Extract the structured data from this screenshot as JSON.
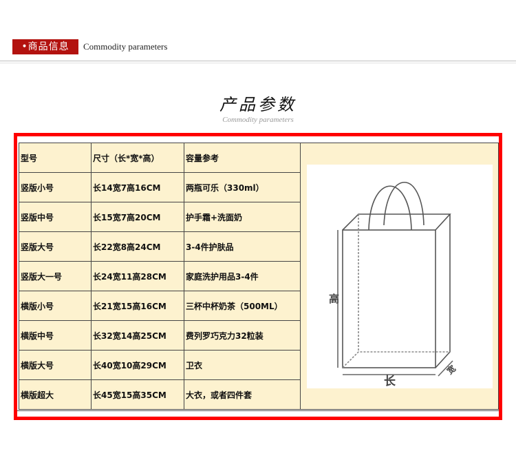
{
  "header": {
    "tag": "•商品信息",
    "subtitle": "Commodity parameters"
  },
  "title": "产品参数",
  "subtitle": "Commodity parameters",
  "table": {
    "headers": [
      "型号",
      "尺寸（长*宽*高）",
      "容量参考"
    ],
    "rows": [
      [
        "竖版小号",
        "长14宽7高16CM",
        "两瓶可乐（330ml）"
      ],
      [
        "竖版中号",
        "长15宽7高20CM",
        "护手霜+洗面奶"
      ],
      [
        "竖版大号",
        "长22宽8高24CM",
        "3-4件护肤品"
      ],
      [
        "竖版大一号",
        "长24宽11高28CM",
        "家庭洗护用品3-4件"
      ],
      [
        "横版小号",
        "长21宽15高16CM",
        "三杯中杯奶茶（500ML）"
      ],
      [
        "横版中号",
        "长32宽14高25CM",
        "费列罗巧克力32粒装"
      ],
      [
        "横版大号",
        "长40宽10高29CM",
        "卫衣"
      ],
      [
        "横版超大",
        "长45宽15高35CM",
        "大衣，或者四件套"
      ]
    ]
  },
  "diagram": {
    "height_label": "高",
    "length_label": "长",
    "width_label": "宽"
  }
}
